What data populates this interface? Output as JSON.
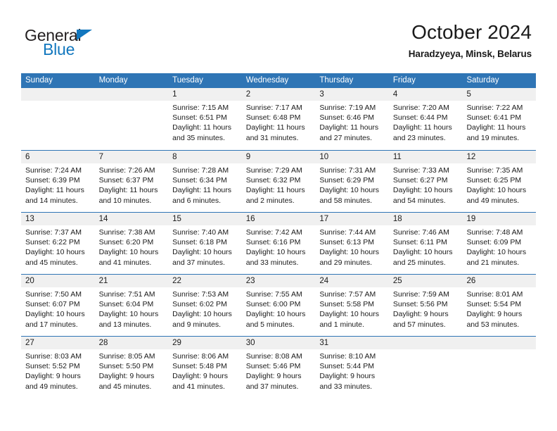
{
  "brand": {
    "name_top": "General",
    "name_bottom": "Blue",
    "color_dark": "#231f20",
    "color_blue": "#1277be"
  },
  "header": {
    "title": "October 2024",
    "subtitle": "Haradzyeya, Minsk, Belarus"
  },
  "theme": {
    "header_blue": "#2f75b5",
    "day_band_gray": "#f0f0f0",
    "cell_white": "#ffffff",
    "text": "#1a1a1a"
  },
  "weekdays": [
    "Sunday",
    "Monday",
    "Tuesday",
    "Wednesday",
    "Thursday",
    "Friday",
    "Saturday"
  ],
  "weeks": [
    [
      {
        "day": "",
        "sunrise": "",
        "sunset": "",
        "daylight": ""
      },
      {
        "day": "",
        "sunrise": "",
        "sunset": "",
        "daylight": ""
      },
      {
        "day": "1",
        "sunrise": "Sunrise: 7:15 AM",
        "sunset": "Sunset: 6:51 PM",
        "daylight": "Daylight: 11 hours and 35 minutes."
      },
      {
        "day": "2",
        "sunrise": "Sunrise: 7:17 AM",
        "sunset": "Sunset: 6:48 PM",
        "daylight": "Daylight: 11 hours and 31 minutes."
      },
      {
        "day": "3",
        "sunrise": "Sunrise: 7:19 AM",
        "sunset": "Sunset: 6:46 PM",
        "daylight": "Daylight: 11 hours and 27 minutes."
      },
      {
        "day": "4",
        "sunrise": "Sunrise: 7:20 AM",
        "sunset": "Sunset: 6:44 PM",
        "daylight": "Daylight: 11 hours and 23 minutes."
      },
      {
        "day": "5",
        "sunrise": "Sunrise: 7:22 AM",
        "sunset": "Sunset: 6:41 PM",
        "daylight": "Daylight: 11 hours and 19 minutes."
      }
    ],
    [
      {
        "day": "6",
        "sunrise": "Sunrise: 7:24 AM",
        "sunset": "Sunset: 6:39 PM",
        "daylight": "Daylight: 11 hours and 14 minutes."
      },
      {
        "day": "7",
        "sunrise": "Sunrise: 7:26 AM",
        "sunset": "Sunset: 6:37 PM",
        "daylight": "Daylight: 11 hours and 10 minutes."
      },
      {
        "day": "8",
        "sunrise": "Sunrise: 7:28 AM",
        "sunset": "Sunset: 6:34 PM",
        "daylight": "Daylight: 11 hours and 6 minutes."
      },
      {
        "day": "9",
        "sunrise": "Sunrise: 7:29 AM",
        "sunset": "Sunset: 6:32 PM",
        "daylight": "Daylight: 11 hours and 2 minutes."
      },
      {
        "day": "10",
        "sunrise": "Sunrise: 7:31 AM",
        "sunset": "Sunset: 6:29 PM",
        "daylight": "Daylight: 10 hours and 58 minutes."
      },
      {
        "day": "11",
        "sunrise": "Sunrise: 7:33 AM",
        "sunset": "Sunset: 6:27 PM",
        "daylight": "Daylight: 10 hours and 54 minutes."
      },
      {
        "day": "12",
        "sunrise": "Sunrise: 7:35 AM",
        "sunset": "Sunset: 6:25 PM",
        "daylight": "Daylight: 10 hours and 49 minutes."
      }
    ],
    [
      {
        "day": "13",
        "sunrise": "Sunrise: 7:37 AM",
        "sunset": "Sunset: 6:22 PM",
        "daylight": "Daylight: 10 hours and 45 minutes."
      },
      {
        "day": "14",
        "sunrise": "Sunrise: 7:38 AM",
        "sunset": "Sunset: 6:20 PM",
        "daylight": "Daylight: 10 hours and 41 minutes."
      },
      {
        "day": "15",
        "sunrise": "Sunrise: 7:40 AM",
        "sunset": "Sunset: 6:18 PM",
        "daylight": "Daylight: 10 hours and 37 minutes."
      },
      {
        "day": "16",
        "sunrise": "Sunrise: 7:42 AM",
        "sunset": "Sunset: 6:16 PM",
        "daylight": "Daylight: 10 hours and 33 minutes."
      },
      {
        "day": "17",
        "sunrise": "Sunrise: 7:44 AM",
        "sunset": "Sunset: 6:13 PM",
        "daylight": "Daylight: 10 hours and 29 minutes."
      },
      {
        "day": "18",
        "sunrise": "Sunrise: 7:46 AM",
        "sunset": "Sunset: 6:11 PM",
        "daylight": "Daylight: 10 hours and 25 minutes."
      },
      {
        "day": "19",
        "sunrise": "Sunrise: 7:48 AM",
        "sunset": "Sunset: 6:09 PM",
        "daylight": "Daylight: 10 hours and 21 minutes."
      }
    ],
    [
      {
        "day": "20",
        "sunrise": "Sunrise: 7:50 AM",
        "sunset": "Sunset: 6:07 PM",
        "daylight": "Daylight: 10 hours and 17 minutes."
      },
      {
        "day": "21",
        "sunrise": "Sunrise: 7:51 AM",
        "sunset": "Sunset: 6:04 PM",
        "daylight": "Daylight: 10 hours and 13 minutes."
      },
      {
        "day": "22",
        "sunrise": "Sunrise: 7:53 AM",
        "sunset": "Sunset: 6:02 PM",
        "daylight": "Daylight: 10 hours and 9 minutes."
      },
      {
        "day": "23",
        "sunrise": "Sunrise: 7:55 AM",
        "sunset": "Sunset: 6:00 PM",
        "daylight": "Daylight: 10 hours and 5 minutes."
      },
      {
        "day": "24",
        "sunrise": "Sunrise: 7:57 AM",
        "sunset": "Sunset: 5:58 PM",
        "daylight": "Daylight: 10 hours and 1 minute."
      },
      {
        "day": "25",
        "sunrise": "Sunrise: 7:59 AM",
        "sunset": "Sunset: 5:56 PM",
        "daylight": "Daylight: 9 hours and 57 minutes."
      },
      {
        "day": "26",
        "sunrise": "Sunrise: 8:01 AM",
        "sunset": "Sunset: 5:54 PM",
        "daylight": "Daylight: 9 hours and 53 minutes."
      }
    ],
    [
      {
        "day": "27",
        "sunrise": "Sunrise: 8:03 AM",
        "sunset": "Sunset: 5:52 PM",
        "daylight": "Daylight: 9 hours and 49 minutes."
      },
      {
        "day": "28",
        "sunrise": "Sunrise: 8:05 AM",
        "sunset": "Sunset: 5:50 PM",
        "daylight": "Daylight: 9 hours and 45 minutes."
      },
      {
        "day": "29",
        "sunrise": "Sunrise: 8:06 AM",
        "sunset": "Sunset: 5:48 PM",
        "daylight": "Daylight: 9 hours and 41 minutes."
      },
      {
        "day": "30",
        "sunrise": "Sunrise: 8:08 AM",
        "sunset": "Sunset: 5:46 PM",
        "daylight": "Daylight: 9 hours and 37 minutes."
      },
      {
        "day": "31",
        "sunrise": "Sunrise: 8:10 AM",
        "sunset": "Sunset: 5:44 PM",
        "daylight": "Daylight: 9 hours and 33 minutes."
      },
      {
        "day": "",
        "sunrise": "",
        "sunset": "",
        "daylight": ""
      },
      {
        "day": "",
        "sunrise": "",
        "sunset": "",
        "daylight": ""
      }
    ]
  ]
}
